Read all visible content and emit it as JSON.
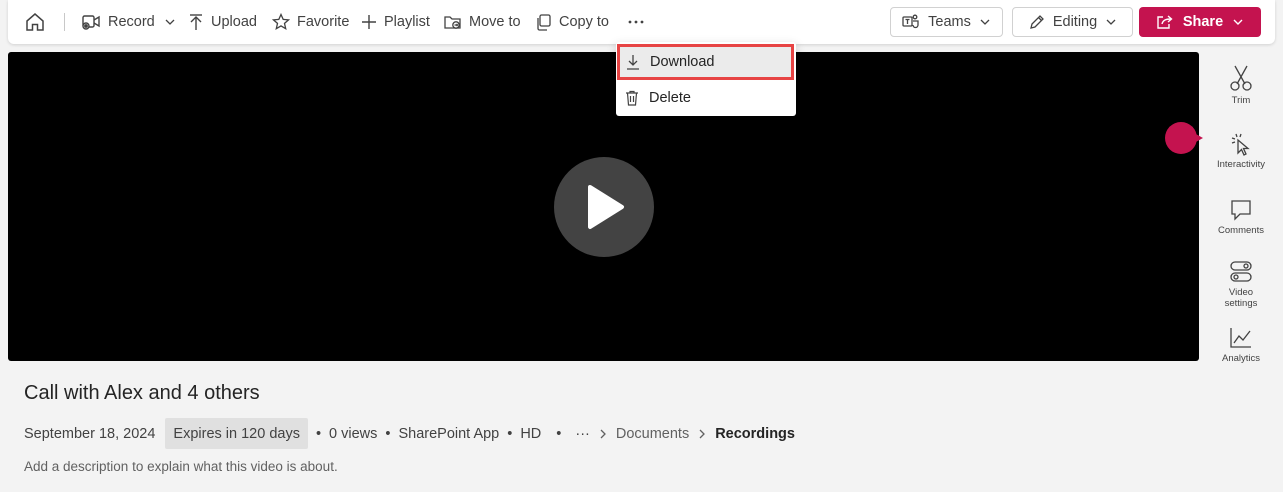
{
  "toolbar": {
    "record": "Record",
    "upload": "Upload",
    "favorite": "Favorite",
    "playlist": "Playlist",
    "move_to": "Move to",
    "copy_to": "Copy to",
    "teams": "Teams",
    "editing": "Editing",
    "share": "Share"
  },
  "menu": {
    "download": "Download",
    "delete": "Delete"
  },
  "rail": {
    "trim": "Trim",
    "interactivity": "Interactivity",
    "comments": "Comments",
    "video_settings": "Video settings",
    "analytics": "Analytics"
  },
  "video": {
    "title": "Call with Alex and 4 others",
    "date": "September 18, 2024",
    "expires": "Expires in 120 days",
    "views": "0 views",
    "app": "SharePoint App",
    "quality": "HD",
    "breadcrumb_more": "···",
    "breadcrumb_parent": "Documents",
    "breadcrumb_current": "Recordings",
    "description_placeholder": "Add a description to explain what this video is about."
  },
  "colors": {
    "accent": "#c4134f",
    "highlight_border": "#e74444"
  }
}
